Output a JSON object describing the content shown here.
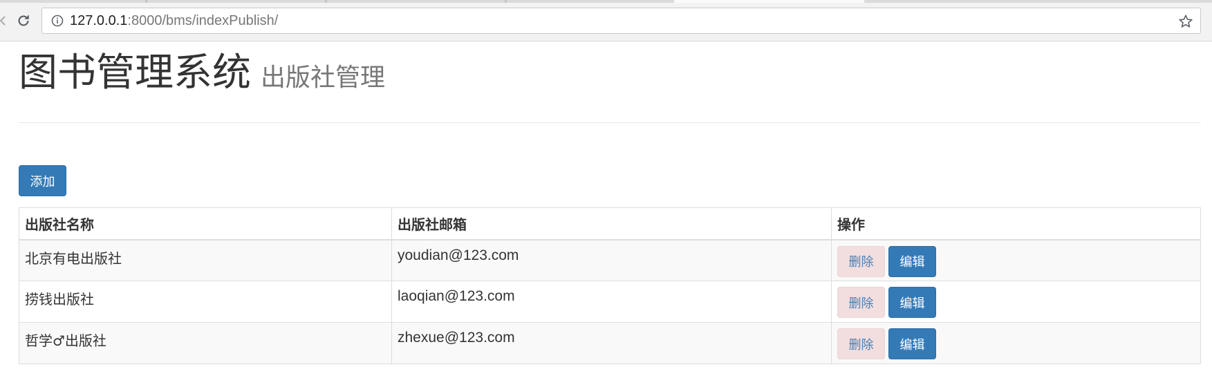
{
  "browser": {
    "url_host": "127.0.0.1",
    "url_rest": ":8000/bms/indexPublish/"
  },
  "header": {
    "title": "图书管理系统",
    "subtitle": "出版社管理"
  },
  "toolbar": {
    "add_label": "添加"
  },
  "table": {
    "columns": [
      "出版社名称",
      "出版社邮箱",
      "操作"
    ],
    "rows": [
      {
        "name": "北京有电出版社",
        "email": "youdian@123.com",
        "delete_label": "删除",
        "edit_label": "编辑"
      },
      {
        "name": "捞钱出版社",
        "email": "laoqian@123.com",
        "delete_label": "删除",
        "edit_label": "编辑"
      },
      {
        "name": "哲学♂出版社",
        "email": "zhexue@123.com",
        "delete_label": "删除",
        "edit_label": "编辑"
      }
    ]
  },
  "colors": {
    "primary": "#337ab7",
    "danger_bg": "#f2dede",
    "stripe": "#f9f9f9"
  }
}
